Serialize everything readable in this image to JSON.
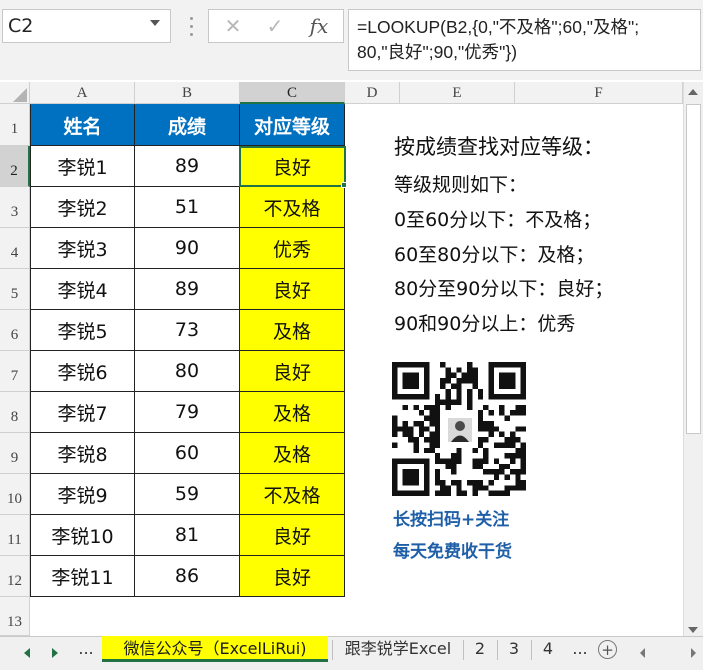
{
  "formula_bar": {
    "name_box": "C2",
    "cancel_symbol": "✕",
    "enter_symbol": "✓",
    "fx_symbol": "fx",
    "formula_line1": "=LOOKUP(B2,{0,\"不及格\";60,\"及格\";",
    "formula_line2": "80,\"良好\";90,\"优秀\"})"
  },
  "columns": [
    "A",
    "B",
    "C",
    "D",
    "E",
    "F"
  ],
  "row_numbers": [
    "1",
    "2",
    "3",
    "4",
    "5",
    "6",
    "7",
    "8",
    "9",
    "10",
    "11",
    "12",
    "13"
  ],
  "table": {
    "headers": [
      "姓名",
      "成绩",
      "对应等级"
    ],
    "rows": [
      [
        "李锐1",
        "89",
        "良好"
      ],
      [
        "李锐2",
        "51",
        "不及格"
      ],
      [
        "李锐3",
        "90",
        "优秀"
      ],
      [
        "李锐4",
        "89",
        "良好"
      ],
      [
        "李锐5",
        "73",
        "及格"
      ],
      [
        "李锐6",
        "80",
        "良好"
      ],
      [
        "李锐7",
        "79",
        "及格"
      ],
      [
        "李锐8",
        "60",
        "及格"
      ],
      [
        "李锐9",
        "59",
        "不及格"
      ],
      [
        "李锐10",
        "81",
        "良好"
      ],
      [
        "李锐11",
        "86",
        "良好"
      ]
    ]
  },
  "notes": {
    "title": "按成绩查找对应等级：",
    "lines": [
      "等级规则如下：",
      "0至60分以下：不及格；",
      "60至80分以下：及格；",
      "80分至90分以下：良好；",
      "90和90分以上：优秀"
    ]
  },
  "qr": {
    "caption1": "长按扫码+关注",
    "caption2": "每天免费收干货"
  },
  "sheet_tabs": {
    "ellipsis": "...",
    "tabs": [
      "微信公众号（ExcelLiRui)",
      "跟李锐学Excel",
      "2",
      "3",
      "4"
    ],
    "active_index": 0,
    "more": "...",
    "add_symbol": "+"
  },
  "colors": {
    "header_fill": "#0070c0",
    "level_fill": "#ffff00",
    "selection": "#217346",
    "caption": "#1f5fa8"
  }
}
